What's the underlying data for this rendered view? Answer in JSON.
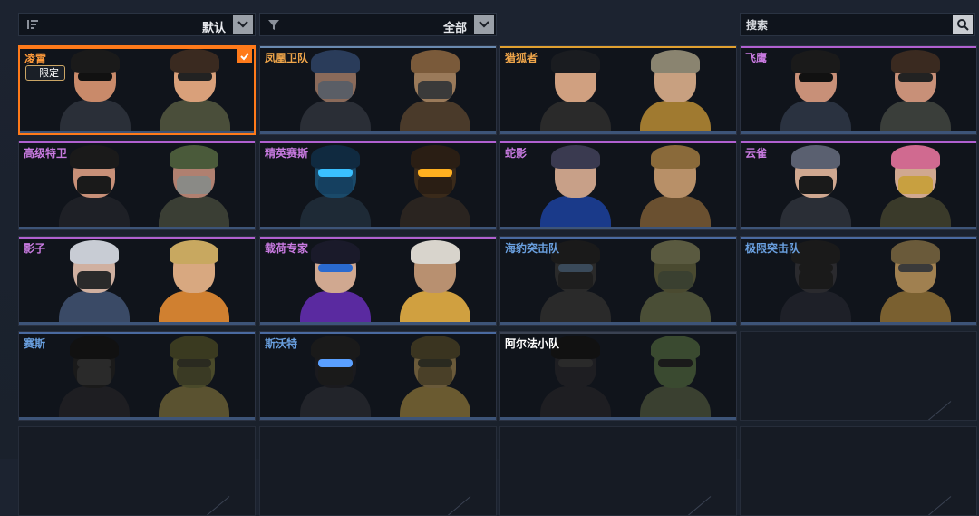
{
  "toolbar": {
    "sort_label": "默认",
    "filter_label": "全部",
    "search_placeholder": "搜索"
  },
  "cards": [
    {
      "name": "凌霄",
      "color": "#ff9a3a",
      "top": "#ff7a1a",
      "badge": "限定",
      "selected": true,
      "skin": [
        "#c98a6a",
        "#d9a07a"
      ],
      "hair": [
        "#1a1a1a",
        "#3a2a20"
      ],
      "body": [
        "#2a2f38",
        "#4a4e3a"
      ],
      "eyes": [
        "#111",
        "#222"
      ],
      "mask": [
        null,
        null
      ]
    },
    {
      "name": "凤凰卫队",
      "color": "#f0a64a",
      "top": "#6a8ab0",
      "skin": [
        "#8a6a5a",
        "#9a7a5a"
      ],
      "hair": [
        "#2a3c5a",
        "#7a5a3a"
      ],
      "body": [
        "#2a2e36",
        "#4a3a2a"
      ],
      "eyes": [
        null,
        null
      ],
      "mask": [
        "#5a5e66",
        "#3a3a3a"
      ]
    },
    {
      "name": "猎狐者",
      "color": "#f0a64a",
      "top": "#e0a030",
      "skin": [
        "#d0a080",
        "#c8a080"
      ],
      "hair": [
        "#1a1c20",
        "#8a8470"
      ],
      "body": [
        "#2a2a2a",
        "#a07a30"
      ],
      "eyes": [
        null,
        null
      ],
      "mask": [
        null,
        null
      ]
    },
    {
      "name": "飞鹰",
      "color": "#c87ae0",
      "top": "#b060d0",
      "skin": [
        "#c89078",
        "#c89078"
      ],
      "hair": [
        "#1a1a1a",
        "#3a2a20"
      ],
      "body": [
        "#2a3240",
        "#3a3e3a"
      ],
      "eyes": [
        "#111",
        "#222"
      ],
      "mask": [
        null,
        null
      ]
    },
    {
      "name": "高级特卫",
      "color": "#c87ae0",
      "top": "#b060d0",
      "skin": [
        "#c89078",
        "#b08070"
      ],
      "hair": [
        "#1a1a1a",
        "#4a5a3a"
      ],
      "body": [
        "#1e2026",
        "#3a3e34"
      ],
      "eyes": [
        null,
        null
      ],
      "mask": [
        "#1a1a1a",
        "#8a8a86"
      ]
    },
    {
      "name": "精英赛斯",
      "color": "#c87ae0",
      "top": "#b060d0",
      "skin": [
        "#1a4a6a",
        "#3a2a1a"
      ],
      "hair": [
        "#102a40",
        "#2a1e14"
      ],
      "body": [
        "#1e2a36",
        "#2a2420"
      ],
      "eyes": [
        "#3ac0ff",
        "#ffb020"
      ],
      "mask": [
        "#154060",
        "#2a1e14"
      ]
    },
    {
      "name": "蛇影",
      "color": "#c87ae0",
      "top": "#b060d0",
      "skin": [
        "#c8a088",
        "#b89068"
      ],
      "hair": [
        "#3a3a50",
        "#8a6a3a"
      ],
      "body": [
        "#1a3a8a",
        "#6a5030"
      ],
      "eyes": [
        null,
        null
      ],
      "mask": [
        null,
        null
      ]
    },
    {
      "name": "云雀",
      "color": "#c87ae0",
      "top": "#b060d0",
      "skin": [
        "#d0a890",
        "#d0a890"
      ],
      "hair": [
        "#5a6070",
        "#d06a90"
      ],
      "body": [
        "#2a2e36",
        "#3a3a2a"
      ],
      "eyes": [
        null,
        null
      ],
      "mask": [
        "#1a1a1a",
        "#c8a040"
      ]
    },
    {
      "name": "影子",
      "color": "#c87ae0",
      "top": "#b060d0",
      "skin": [
        "#d0b0a0",
        "#d8a880"
      ],
      "hair": [
        "#c8ccd4",
        "#c8a860"
      ],
      "body": [
        "#3a4a66",
        "#d08030"
      ],
      "eyes": [
        null,
        null
      ],
      "mask": [
        "#2a2a2a",
        null
      ]
    },
    {
      "name": "载荷专家",
      "color": "#c87ae0",
      "top": "#b060d0",
      "skin": [
        "#d0a890",
        "#b89070"
      ],
      "hair": [
        "#1a1a2a",
        "#d8d4cc"
      ],
      "body": [
        "#5a2aa0",
        "#d0a040"
      ],
      "eyes": [
        "#2a6ad0",
        null
      ],
      "mask": [
        null,
        "#b89070"
      ]
    },
    {
      "name": "海豹突击队",
      "color": "#6aa0e0",
      "top": "#4a6aa0",
      "skin": [
        "#2a2a2a",
        "#4a4a30"
      ],
      "hair": [
        "#1a1a1a",
        "#5a5a40"
      ],
      "body": [
        "#2a2a2a",
        "#4a4e36"
      ],
      "eyes": [
        "#3a4a5a",
        null
      ],
      "mask": [
        "#1e1e1e",
        "#3a4030"
      ]
    },
    {
      "name": "极限突击队",
      "color": "#6aa0e0",
      "top": "#4a6aa0",
      "skin": [
        "#2a2a2e",
        "#a08050"
      ],
      "hair": [
        "#1a1a1a",
        "#6a5a3a"
      ],
      "body": [
        "#1e2028",
        "#7a6030"
      ],
      "eyes": [
        "#1a1a1a",
        "#3a3a3a"
      ],
      "mask": [
        "#1a1a1a",
        "#a08050"
      ]
    },
    {
      "name": "赛斯",
      "color": "#6aa0e0",
      "top": "#4a6aa0",
      "skin": [
        "#1a1a1a",
        "#4a4a2a"
      ],
      "hair": [
        "#111",
        "#3a3a20"
      ],
      "body": [
        "#1e1e22",
        "#5a5230"
      ],
      "eyes": [
        "#2a2a2a",
        "#2a2a20"
      ],
      "mask": [
        "#2a2a2a",
        "#3a3a24"
      ]
    },
    {
      "name": "斯沃特",
      "color": "#6aa0e0",
      "top": "#4a6aa0",
      "skin": [
        "#1a1a1e",
        "#6a5a3a"
      ],
      "hair": [
        "#1a1a1a",
        "#3a3420"
      ],
      "body": [
        "#22242a",
        "#6a5a30"
      ],
      "eyes": [
        "#5aa0ff",
        "#2a2a20"
      ],
      "mask": [
        "#1a1a1a",
        "#4a4028"
      ]
    },
    {
      "name": "阿尔法小队",
      "color": "#ffffff",
      "top": "#3a4252",
      "skin": [
        "#1e1e22",
        "#3a4a30"
      ],
      "hair": [
        "#111",
        "#3a4a30"
      ],
      "body": [
        "#1e1e22",
        "#3a4030"
      ],
      "eyes": [
        "#2a2a2a",
        "#1a1a1a"
      ],
      "mask": [
        "#1e1e22",
        "#3a4a30"
      ]
    }
  ]
}
